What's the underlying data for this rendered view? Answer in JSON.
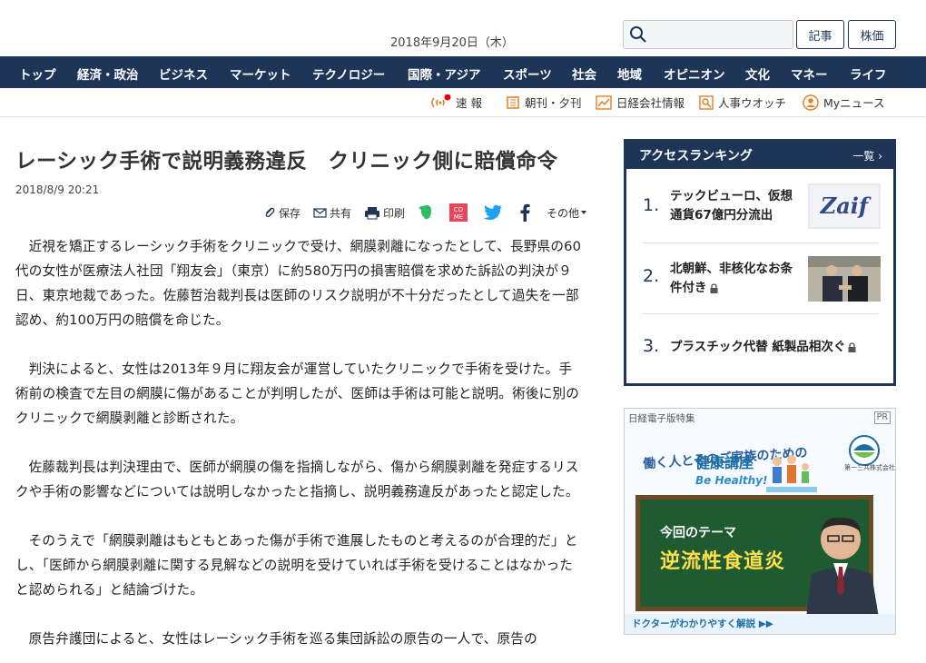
{
  "header": {
    "date": "2018年9月20日（木）",
    "search_placeholder": "",
    "btn_kiji": "記事",
    "btn_kabuka": "株価"
  },
  "nav": [
    "トップ",
    "経済・政治",
    "ビジネス",
    "マーケット",
    "テクノロジー",
    "国際・アジア",
    "スポーツ",
    "社会",
    "地域",
    "オピニオン",
    "文化",
    "マネー",
    "ライフ"
  ],
  "subnav": {
    "breaking": "速 報",
    "paper": "朝刊・夕刊",
    "company": "日経会社情報",
    "jinji": "人事ウオッチ",
    "mynews": "Myニュース"
  },
  "article": {
    "headline": "レーシック手術で説明義務違反　クリニック側に賠償命令",
    "date": "2018/8/9 20:21",
    "share": {
      "save": "保存",
      "share": "共有",
      "print": "印刷",
      "other": "その他"
    },
    "paragraphs": [
      "近視を矯正するレーシック手術をクリニックで受け、網膜剥離になったとして、長野県の60代の女性が医療法人社団「翔友会」（東京）に約580万円の損害賠償を求めた訴訟の判決が９日、東京地裁であった。佐藤哲治裁判長は医師のリスク説明が不十分だったとして過失を一部認め、約100万円の賠償を命じた。",
      "判決によると、女性は2013年９月に翔友会が運営していたクリニックで手術を受けた。手術前の検査で左目の網膜に傷があることが判明したが、医師は手術は可能と説明。術後に別のクリニックで網膜剥離と診断された。",
      "佐藤裁判長は判決理由で、医師が網膜の傷を指摘しながら、傷から網膜剥離を発症するリスクや手術の影響などについては説明しなかったと指摘し、説明義務違反があったと認定した。",
      "そのうえで「網膜剥離はもともとあった傷が手術で進展したものと考えるのが合理的だ」とし、「医師から網膜剥離に関する見解などの説明を受けていれば手術を受けることはなかったと認められる」と結論づけた。",
      "原告弁護団によると、女性はレーシック手術を巡る集団訴訟の原告の一人で、原告の"
    ]
  },
  "ranking": {
    "title": "アクセスランキング",
    "more": "一覧",
    "items": [
      {
        "num": "1.",
        "text": "テックビューロ、仮想通貨67億円分流出",
        "locked": false,
        "thumb": "zaif-logo"
      },
      {
        "num": "2.",
        "text": "北朝鮮、非核化なお条件付き",
        "locked": true,
        "thumb": "summit-photo"
      },
      {
        "num": "3.",
        "text": "プラスチック代替 紙製品相次ぐ",
        "locked": true,
        "thumb": ""
      }
    ]
  },
  "ad": {
    "label": "日経電子版特集",
    "pr": "PR",
    "tagline": "働く人とそのご家族のための",
    "title": "健康講座",
    "behealthy": "Be Healthy!",
    "sponsor": "第一三共株式会社",
    "theme_label": "今回のテーマ",
    "theme": "逆流性食道炎",
    "footer": "ドクターがわかりやすく解説 ▶▶"
  },
  "colors": {
    "navy": "#1e3557",
    "accent_red": "#e60012"
  }
}
